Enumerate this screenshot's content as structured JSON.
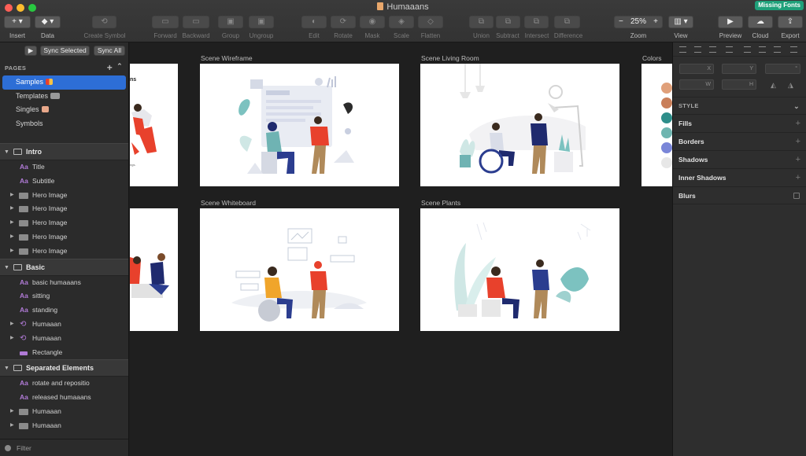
{
  "window": {
    "title": "Humaaans",
    "badge": "Missing Fonts"
  },
  "toolbar": {
    "insert": "Insert",
    "data": "Data",
    "create_symbol": "Create Symbol",
    "forward": "Forward",
    "backward": "Backward",
    "group": "Group",
    "ungroup": "Ungroup",
    "edit": "Edit",
    "rotate": "Rotate",
    "mask": "Mask",
    "scale": "Scale",
    "flatten": "Flatten",
    "union": "Union",
    "subtract": "Subtract",
    "intersect": "Intersect",
    "difference": "Difference",
    "zoom": "Zoom",
    "zoom_value": "25%",
    "zoom_minus": "−",
    "zoom_plus": "+",
    "view": "View",
    "preview": "Preview",
    "cloud": "Cloud",
    "export": "Export"
  },
  "sidebar": {
    "sync_selected": "Sync Selected",
    "sync_all": "Sync All",
    "pages_header": "PAGES",
    "pages": [
      {
        "label": "Samples"
      },
      {
        "label": "Templates"
      },
      {
        "label": "Singles"
      },
      {
        "label": "Symbols"
      }
    ],
    "groups": [
      {
        "label": "Intro",
        "layers": [
          {
            "label": "Title",
            "kind": "text"
          },
          {
            "label": "Subtitle",
            "kind": "text"
          },
          {
            "label": "Hero Image",
            "kind": "folder"
          },
          {
            "label": "Hero Image",
            "kind": "folder"
          },
          {
            "label": "Hero Image",
            "kind": "folder"
          },
          {
            "label": "Hero Image",
            "kind": "folder"
          },
          {
            "label": "Hero Image",
            "kind": "folder"
          }
        ]
      },
      {
        "label": "Basic",
        "layers": [
          {
            "label": "basic humaaans",
            "kind": "text"
          },
          {
            "label": "sitting",
            "kind": "text"
          },
          {
            "label": "standing",
            "kind": "text"
          },
          {
            "label": "Humaaan",
            "kind": "symbol"
          },
          {
            "label": "Humaaan",
            "kind": "symbol"
          },
          {
            "label": "Rectangle",
            "kind": "rect"
          }
        ]
      },
      {
        "label": "Separated Elements",
        "layers": [
          {
            "label": "rotate and repositio",
            "kind": "text"
          },
          {
            "label": "released humaaans",
            "kind": "text"
          },
          {
            "label": "Humaaan",
            "kind": "folder"
          },
          {
            "label": "Humaaan",
            "kind": "folder"
          }
        ]
      }
    ],
    "filter_label": "Filter"
  },
  "canvas": {
    "artboards": [
      {
        "title": "Scene Wireframe"
      },
      {
        "title": "Scene Living Room"
      },
      {
        "title": "Colors"
      },
      {
        "title": "Scene Whiteboard"
      },
      {
        "title": "Scene Plants"
      }
    ],
    "partial_text": "ns",
    "partial_text2": "ngs."
  },
  "inspector": {
    "x_label": "X",
    "y_label": "Y",
    "w_label": "W",
    "h_label": "H",
    "style_header": "STYLE",
    "rows": [
      {
        "label": "Fills"
      },
      {
        "label": "Borders"
      },
      {
        "label": "Shadows"
      },
      {
        "label": "Inner Shadows"
      },
      {
        "label": "Blurs"
      }
    ]
  },
  "colors": {
    "accent": "#2d6ed6",
    "swatches": [
      "#e0a07a",
      "#c97f5a",
      "#2e8e8a",
      "#6fb5b0",
      "#7a86d8",
      "#e7e7e7"
    ],
    "red": "#e8412c",
    "navy": "#1f2a6e",
    "teal": "#6fb3b3",
    "badge": "#1fa07a"
  }
}
